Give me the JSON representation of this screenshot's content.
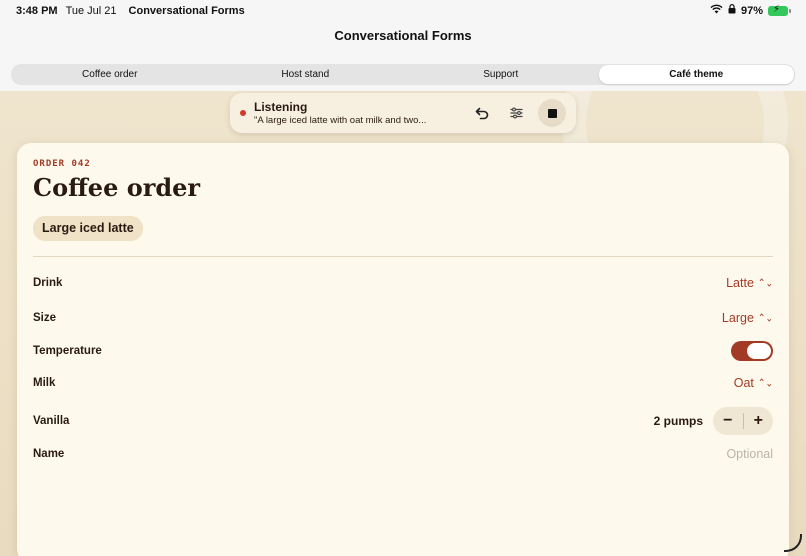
{
  "status_bar": {
    "time": "3:48 PM",
    "date": "Tue Jul 21",
    "app_name": "Conversational Forms",
    "battery": "97%"
  },
  "nav": {
    "title": "Conversational Forms"
  },
  "tabs": [
    {
      "label": "Coffee order"
    },
    {
      "label": "Host stand"
    },
    {
      "label": "Support"
    },
    {
      "label": "Café theme",
      "active": true
    }
  ],
  "listening": {
    "title": "Listening",
    "transcript": "\"A large iced latte with oat milk and two...",
    "icons": [
      "undo-icon",
      "sliders-icon",
      "stop-icon"
    ]
  },
  "card": {
    "order_label": "ORDER 042",
    "title": "Coffee order",
    "chip": "Large iced latte",
    "rows": {
      "drink": {
        "label": "Drink",
        "value": "Latte"
      },
      "size": {
        "label": "Size",
        "value": "Large"
      },
      "temperature": {
        "label": "Temperature",
        "on": true
      },
      "milk": {
        "label": "Milk",
        "value": "Oat"
      },
      "vanilla": {
        "label": "Vanilla",
        "value": "2 pumps",
        "minus": "−",
        "plus": "+"
      },
      "name": {
        "label": "Name",
        "placeholder": "Optional",
        "value": ""
      }
    }
  },
  "colors": {
    "accent": "#a33a26",
    "card_bg": "#fdf9ed",
    "cafe_bg": "#ecdfc5",
    "text_dark": "#2a1a12"
  }
}
